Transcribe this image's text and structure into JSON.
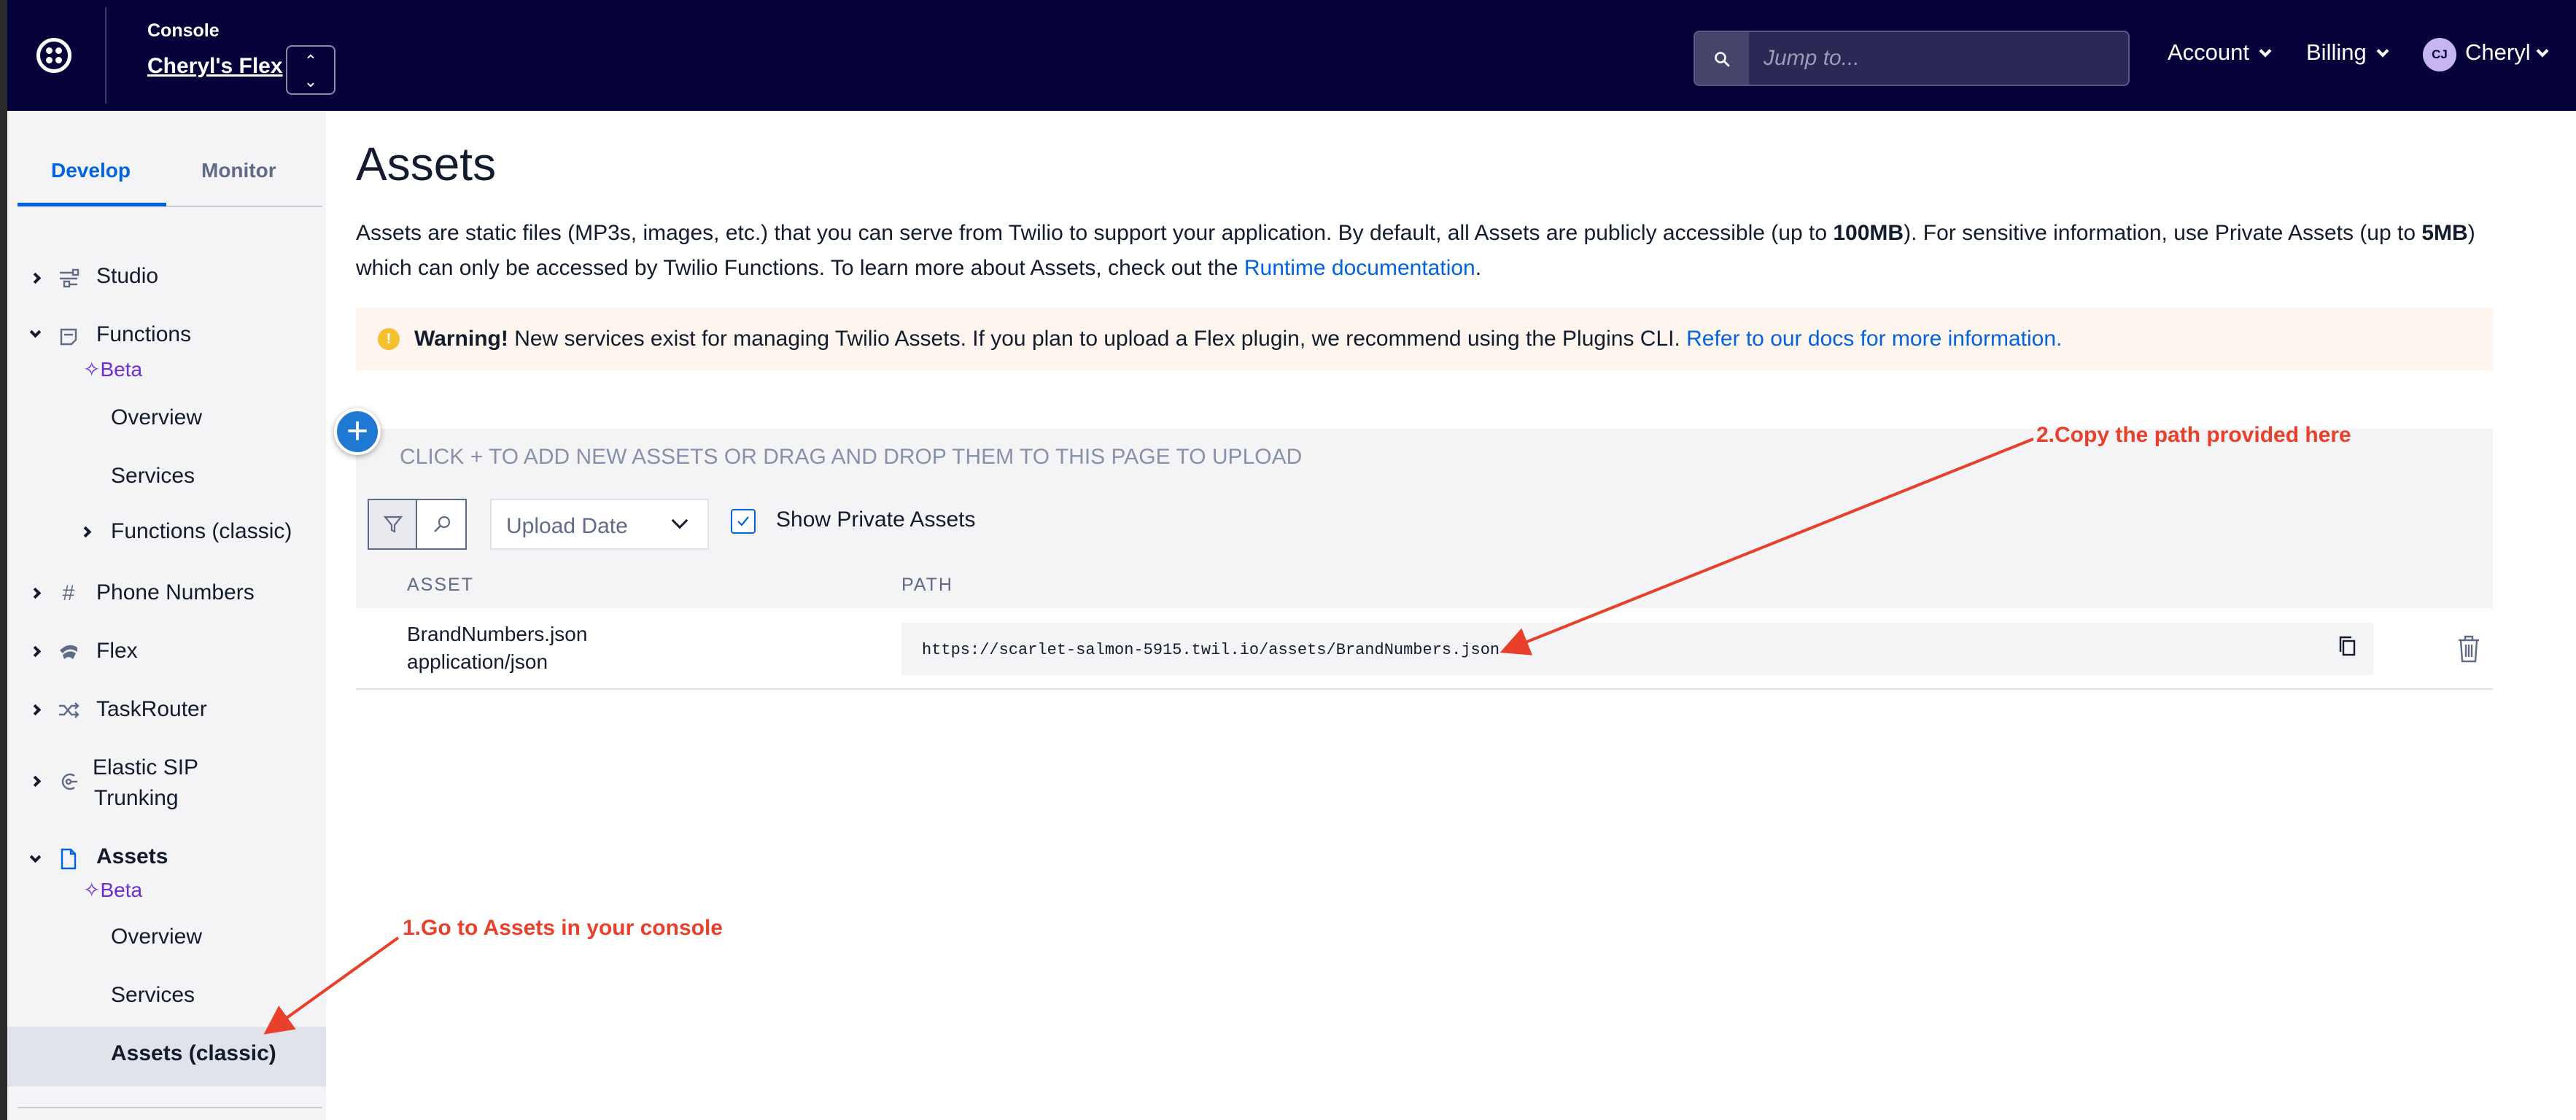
{
  "topbar": {
    "console_label": "Console",
    "account_name": "Cheryl's Flex",
    "search_placeholder": "Jump to...",
    "account_menu": "Account",
    "billing_menu": "Billing",
    "avatar_initials": "CJ",
    "user_name": "Cheryl"
  },
  "sidebar": {
    "tabs": [
      {
        "label": "Develop",
        "active": true
      },
      {
        "label": "Monitor",
        "active": false
      }
    ],
    "items": {
      "studio": "Studio",
      "functions": "Functions",
      "functions_beta": "Beta",
      "functions_overview": "Overview",
      "functions_services": "Services",
      "functions_classic": "Functions (classic)",
      "phone_numbers": "Phone Numbers",
      "flex": "Flex",
      "taskrouter": "TaskRouter",
      "elastic_sip_1": "Elastic SIP",
      "elastic_sip_2": "Trunking",
      "assets": "Assets",
      "assets_beta": "Beta",
      "assets_overview": "Overview",
      "assets_services": "Services",
      "assets_classic": "Assets (classic)"
    }
  },
  "main": {
    "title": "Assets",
    "intro": {
      "p1": "Assets are static files (MP3s, images, etc.) that you can serve from Twilio to support your application. By default, all Assets are publicly accessible (up to ",
      "b1": "100MB",
      "p2": "). For sensitive information, use Private Assets (up to ",
      "b2": "5MB",
      "p3": ") which can only be accessed by Twilio Functions. To learn more about Assets, check out the ",
      "link": "Runtime documentation",
      "p4": "."
    },
    "warning": {
      "label": "Warning!",
      "text": " New services exist for managing Twilio Assets. If you plan to upload a Flex plugin, we recommend using the Plugins CLI. ",
      "link": "Refer to our docs for more information."
    },
    "upload_hint": "CLICK + TO ADD NEW ASSETS OR DRAG AND DROP THEM TO THIS PAGE TO UPLOAD",
    "sort_select": "Upload Date",
    "show_private_label": "Show Private Assets",
    "show_private_checked": true,
    "columns": [
      "ASSET",
      "PATH"
    ],
    "rows": [
      {
        "name": "BrandNumbers.json",
        "type": "application/json",
        "path": "https://scarlet-salmon-5915.twil.io/assets/BrandNumbers.json"
      }
    ]
  },
  "annotations": {
    "step1": "1.Go to Assets in your console",
    "step2": "2.Copy the path provided here"
  },
  "colors": {
    "topbar": "#06033a",
    "link": "#0263e0",
    "annotation": "#e8402a",
    "beta": "#6d2ed1"
  }
}
